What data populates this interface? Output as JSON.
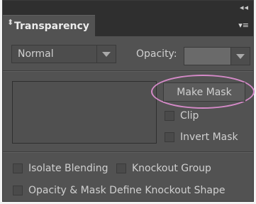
{
  "panel": {
    "collapse_glyph": "◂◂",
    "tab_icon": "⬍",
    "tab_title": "Transparency",
    "menu_glyph": "▾≡"
  },
  "blending": {
    "mode": "Normal",
    "opacity_label": "Opacity:",
    "opacity_value": ""
  },
  "mask": {
    "make_mask_label": "Make Mask",
    "clip_label": "Clip",
    "invert_mask_label": "Invert Mask"
  },
  "options": {
    "isolate_blending_label": "Isolate Blending",
    "knockout_group_label": "Knockout Group",
    "opacity_mask_knockout_label": "Opacity & Mask Define Knockout Shape"
  },
  "colors": {
    "panel_bg": "#525252",
    "header_bg": "#2f2f2f",
    "highlight_ring": "#d58ac8"
  }
}
